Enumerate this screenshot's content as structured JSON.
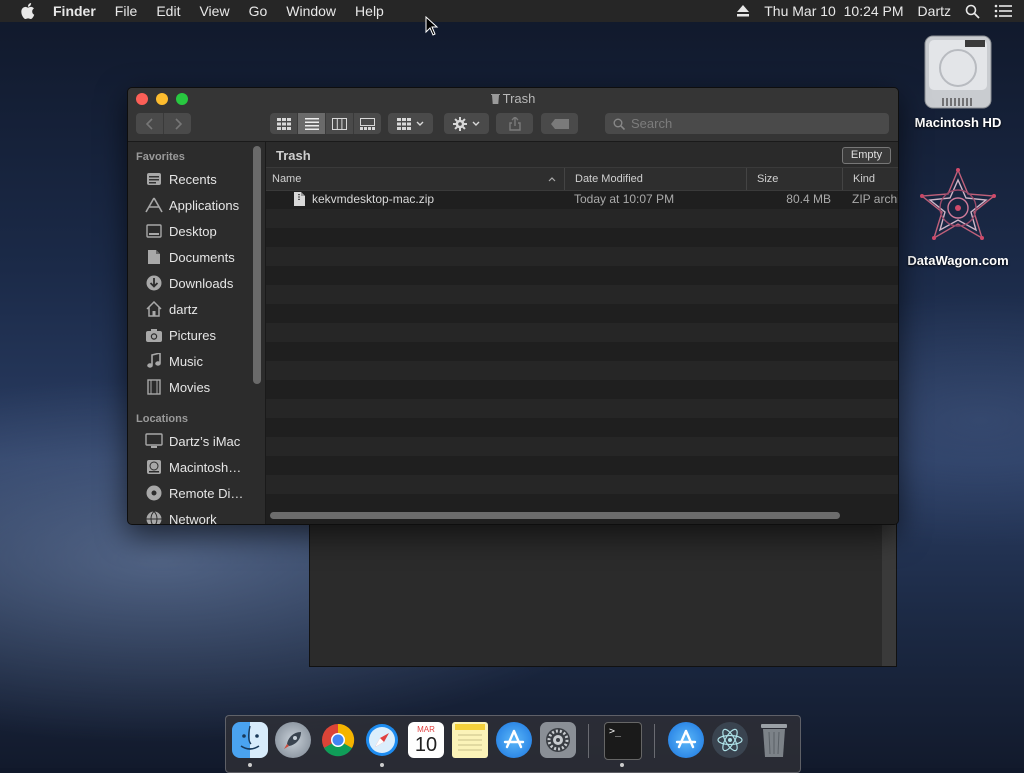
{
  "menubar": {
    "items": [
      "Finder",
      "File",
      "Edit",
      "View",
      "Go",
      "Window",
      "Help"
    ],
    "clock": "Thu Mar 10  10:24 PM",
    "user": "Dartz"
  },
  "desktop": {
    "icons": [
      {
        "label": "Macintosh HD",
        "icon": "hard-drive-icon"
      },
      {
        "label": "DataWagon.com",
        "icon": "datawagon-logo-icon"
      }
    ]
  },
  "window": {
    "title": "Trash",
    "search_placeholder": "Search",
    "path_title": "Trash",
    "empty_label": "Empty"
  },
  "sidebar": {
    "favorites_heading": "Favorites",
    "favorites": [
      {
        "label": "Recents",
        "icon": "recents-icon"
      },
      {
        "label": "Applications",
        "icon": "applications-icon"
      },
      {
        "label": "Desktop",
        "icon": "desktop-icon"
      },
      {
        "label": "Documents",
        "icon": "documents-icon"
      },
      {
        "label": "Downloads",
        "icon": "downloads-icon"
      },
      {
        "label": "dartz",
        "icon": "home-icon"
      },
      {
        "label": "Pictures",
        "icon": "pictures-icon"
      },
      {
        "label": "Music",
        "icon": "music-icon"
      },
      {
        "label": "Movies",
        "icon": "movies-icon"
      }
    ],
    "locations_heading": "Locations",
    "locations": [
      {
        "label": "Dartz’s iMac",
        "icon": "computer-icon"
      },
      {
        "label": "Macintosh…",
        "icon": "disk-icon"
      },
      {
        "label": "Remote Di…",
        "icon": "remote-disc-icon"
      },
      {
        "label": "Network",
        "icon": "network-icon"
      }
    ]
  },
  "table": {
    "columns": [
      "Name",
      "Date Modified",
      "Size",
      "Kind"
    ],
    "rows": [
      {
        "name": "kekvmdesktop-mac.zip",
        "date": "Today at 10:07 PM",
        "size": "80.4 MB",
        "kind": "ZIP archive"
      }
    ]
  },
  "dock": {
    "apps": [
      "Finder",
      "Launchpad",
      "Chrome",
      "Safari",
      "Calendar",
      "Notes",
      "App Store",
      "System Preferences",
      "Terminal",
      "App Store",
      "Atom",
      "Trash"
    ],
    "calendar_month": "MAR",
    "calendar_day": "10"
  },
  "colors": {
    "close": "#fc5f57",
    "minimize": "#fdbc2e",
    "maximize": "#28c840"
  }
}
